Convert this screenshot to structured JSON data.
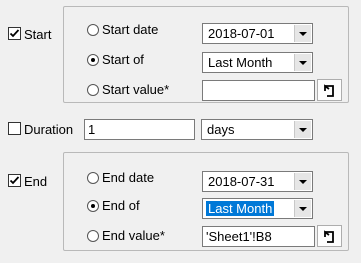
{
  "start": {
    "checkbox_label": "Start",
    "checked": true,
    "options": {
      "date_label": "Start date",
      "of_label": "Start of",
      "value_label": "Start value*"
    },
    "selected_option": "of",
    "date_value": "2018-07-01",
    "of_value": "Last Month",
    "value_value": ""
  },
  "duration": {
    "checkbox_label": "Duration",
    "checked": false,
    "amount": "1",
    "unit": "days"
  },
  "end": {
    "checkbox_label": "End",
    "checked": true,
    "options": {
      "date_label": "End date",
      "of_label": "End of",
      "value_label": "End value*"
    },
    "selected_option": "of",
    "date_value": "2018-07-31",
    "of_value": "Last Month",
    "value_value": "'Sheet1'!B8"
  },
  "icons": {
    "checkbox_check": "check-mark",
    "dropdown": "chevron-down-icon",
    "reference": "cell-reference-icon"
  },
  "colors": {
    "selection": "#0078d7",
    "group_border": "#b9b9b9"
  }
}
